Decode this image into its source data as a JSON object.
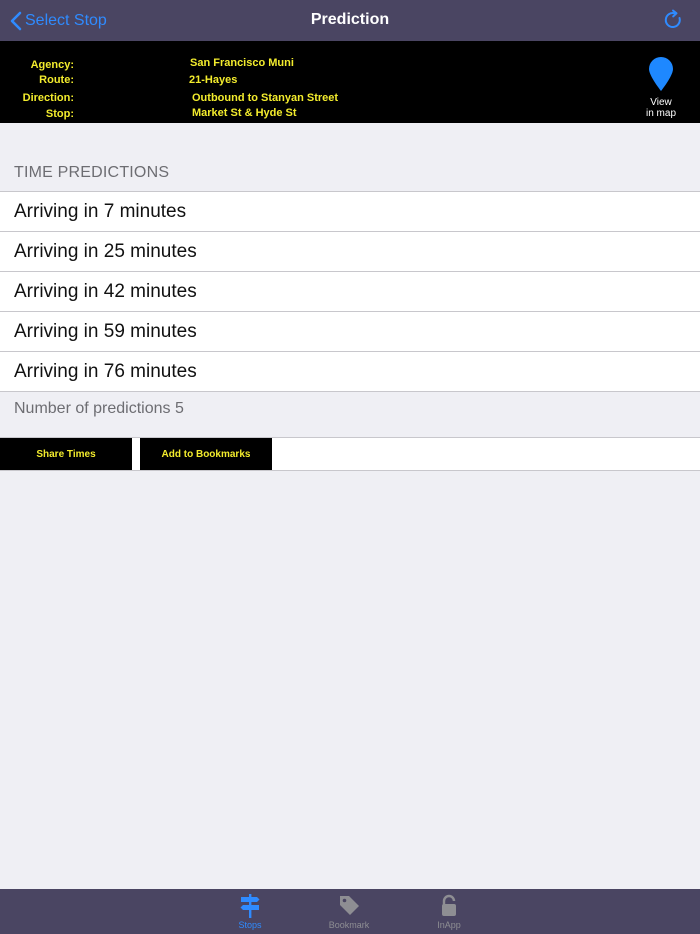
{
  "nav": {
    "back_label": "Select Stop",
    "title": "Prediction"
  },
  "info": {
    "agency_label": "Agency:",
    "agency": "San Francisco Muni",
    "route_label": "Route:",
    "route": "21-Hayes",
    "direction_label": "Direction:",
    "direction": "Outbound to Stanyan Street",
    "stop_label": "Stop:",
    "stop": "Market St & Hyde St",
    "map_label_line1": "View",
    "map_label_line2": "in map"
  },
  "predictions": {
    "header": "TIME PREDICTIONS",
    "items": [
      "Arriving in 7 minutes",
      "Arriving in 25 minutes",
      "Arriving in 42 minutes",
      "Arriving in 59 minutes",
      "Arriving in 76 minutes"
    ],
    "footer": "Number of predictions 5"
  },
  "actions": {
    "share": "Share Times",
    "bookmark": "Add to Bookmarks"
  },
  "tabbar": {
    "tabs": [
      {
        "label": "Stops",
        "icon": "signpost-icon",
        "active": true
      },
      {
        "label": "Bookmark",
        "icon": "tag-icon",
        "active": false
      },
      {
        "label": "InApp",
        "icon": "lock-icon",
        "active": false
      }
    ]
  },
  "colors": {
    "nav_bg": "#4a4562",
    "accent": "#2f8bff",
    "info_text": "#f3ec2d",
    "info_bg": "#000000"
  }
}
